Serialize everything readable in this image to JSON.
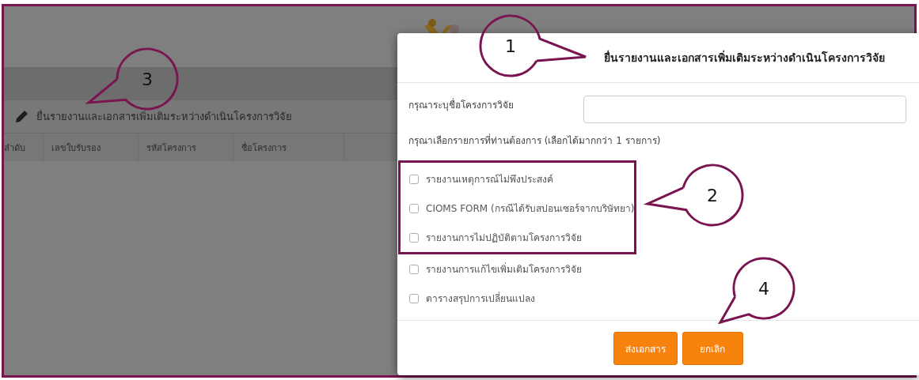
{
  "page": {
    "section_title": "ยื่นรายงานและเอกสารเพิ่มเติมระหว่างดำเนินโครงการวิจัย",
    "table": {
      "columns": [
        "ลำดับ",
        "เลขใบรับรอง",
        "รหัสโครงการ",
        "ชื่อโครงการ"
      ]
    }
  },
  "dialog": {
    "title": "ยื่นรายงานและเอกสารเพิ่มเติมระหว่างดำเนินโครงการวิจัย",
    "project_name": {
      "label": "กรุณาระบุชื่อโครงการวิจัย"
    },
    "choose_label": "กรุณาเลือกรายการที่ท่านต้องการ (เลือกได้มากกว่า 1 รายการ)",
    "options": [
      {
        "label": "รายงานเหตุการณ์ไม่พึงประสงค์",
        "checked": false,
        "highlighted": true
      },
      {
        "label": "CIOMS FORM (กรณีได้รับสปอนเซอร์จากบริษัทยา)",
        "checked": false,
        "highlighted": true
      },
      {
        "label": "รายงานการไม่ปฏิบัติตามโครงการวิจัย",
        "checked": false,
        "highlighted": true
      },
      {
        "label": "รายงานการแก้ไขเพิ่มเติมโครงการวิจัย",
        "checked": false,
        "highlighted": false
      },
      {
        "label": "ตารางสรุปการเปลี่ยนแปลง",
        "checked": false,
        "highlighted": false
      }
    ],
    "buttons": [
      "ส่งเอกสาร",
      "ยกเลิก"
    ]
  },
  "callouts": [
    "1",
    "2",
    "3",
    "4"
  ]
}
